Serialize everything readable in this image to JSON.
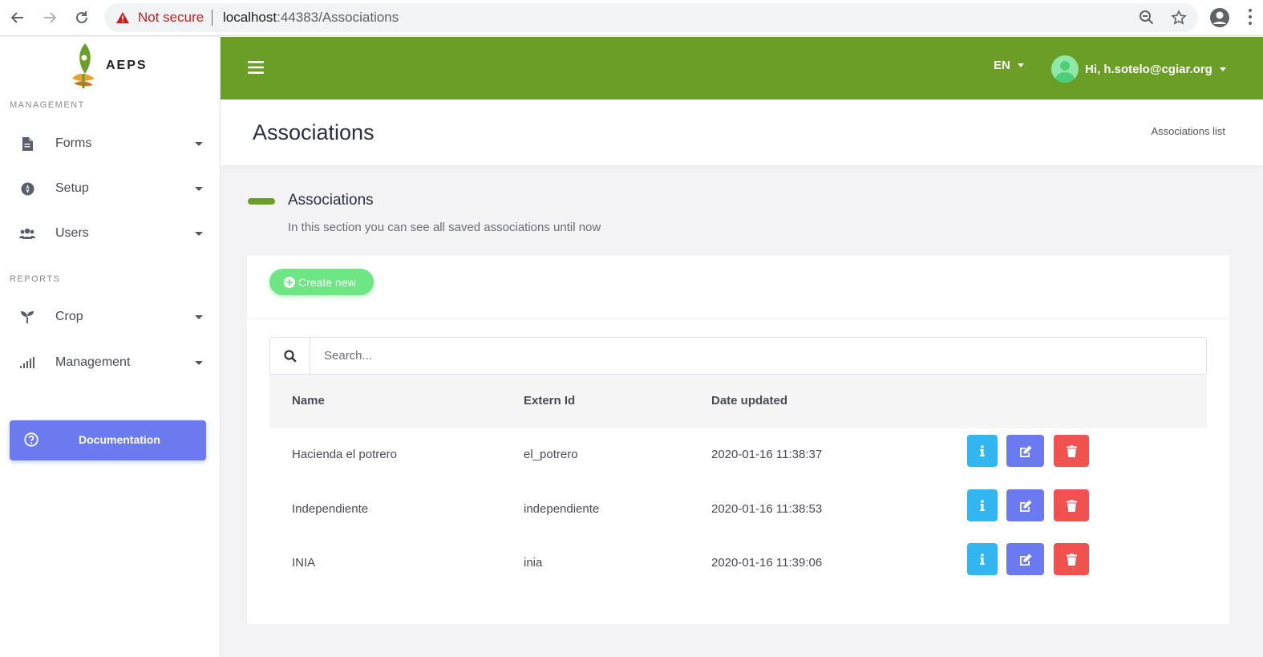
{
  "browser": {
    "security_label": "Not secure",
    "url_host": "localhost",
    "url_path": ":44383/Associations"
  },
  "sidebar": {
    "logo_text": "AEPS",
    "management_title": "MANAGEMENT",
    "reports_title": "REPORTS",
    "items": [
      {
        "label": "Forms",
        "icon": "file-icon"
      },
      {
        "label": "Setup",
        "icon": "compass-icon"
      },
      {
        "label": "Users",
        "icon": "users-icon"
      },
      {
        "label": "Crop",
        "icon": "seedling-icon"
      },
      {
        "label": "Management",
        "icon": "signal-icon"
      }
    ],
    "documentation_label": "Documentation"
  },
  "header": {
    "language": "EN",
    "user_greeting": "Hi, h.sotelo@cgiar.org"
  },
  "page": {
    "title": "Associations",
    "breadcrumb": "Associations list",
    "section_title": "Associations",
    "section_description": "In this section you can see all saved associations until now"
  },
  "card": {
    "create_label": "Create new",
    "search_placeholder": "Search...",
    "columns": [
      "Name",
      "Extern Id",
      "Date updated"
    ],
    "rows": [
      {
        "name": "Hacienda el potrero",
        "extern_id": "el_potrero",
        "date_updated": "2020-01-16 11:38:37"
      },
      {
        "name": "Independiente",
        "extern_id": "independiente",
        "date_updated": "2020-01-16 11:38:53"
      },
      {
        "name": "INIA",
        "extern_id": "inia",
        "date_updated": "2020-01-16 11:39:06"
      }
    ]
  },
  "colors": {
    "brand_green": "#6b9e27",
    "create_green": "#6ee683",
    "info_blue": "#32b6f0",
    "edit_indigo": "#6c7af0",
    "delete_red": "#f0534f"
  }
}
